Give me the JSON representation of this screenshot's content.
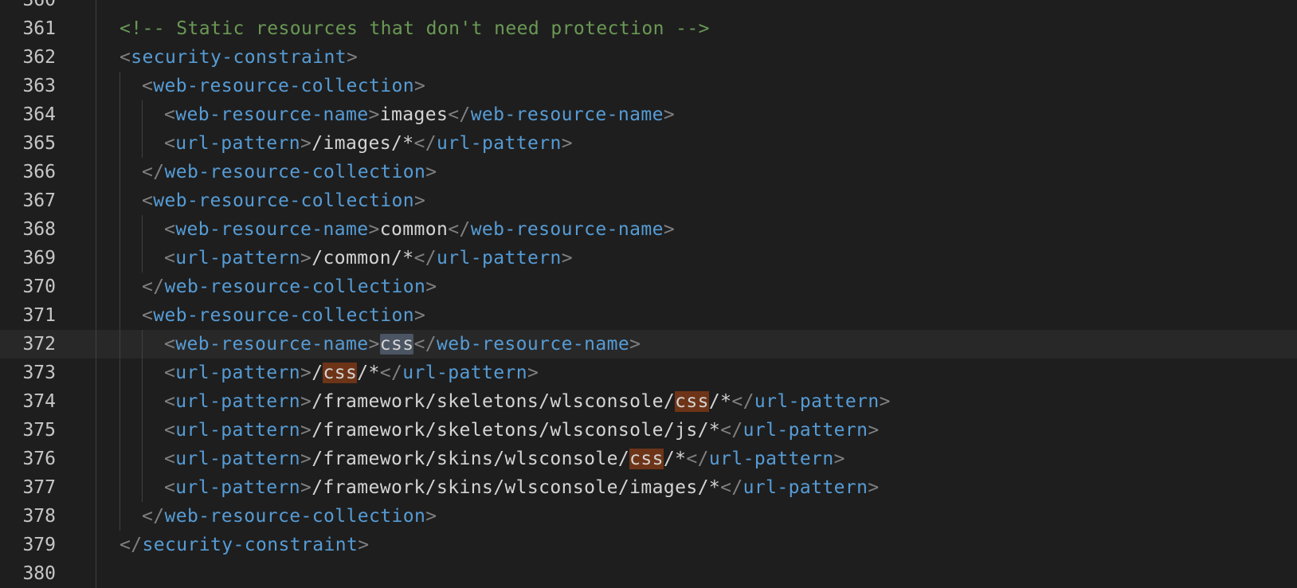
{
  "editor": {
    "lines": [
      {
        "num": "360",
        "indent": 0,
        "tokens": []
      },
      {
        "num": "361",
        "indent": 0,
        "tokens": [
          {
            "t": "comment",
            "v": "<!-- Static resources that don't need protection -->"
          }
        ]
      },
      {
        "num": "362",
        "indent": 0,
        "tokens": [
          {
            "t": "bracket",
            "v": "<"
          },
          {
            "t": "tag",
            "v": "security-constraint"
          },
          {
            "t": "bracket",
            "v": ">"
          }
        ]
      },
      {
        "num": "363",
        "indent": 1,
        "tokens": [
          {
            "t": "bracket",
            "v": "<"
          },
          {
            "t": "tag",
            "v": "web-resource-collection"
          },
          {
            "t": "bracket",
            "v": ">"
          }
        ]
      },
      {
        "num": "364",
        "indent": 2,
        "tokens": [
          {
            "t": "bracket",
            "v": "<"
          },
          {
            "t": "tag",
            "v": "web-resource-name"
          },
          {
            "t": "bracket",
            "v": ">"
          },
          {
            "t": "text",
            "v": "images"
          },
          {
            "t": "bracket",
            "v": "</"
          },
          {
            "t": "tag",
            "v": "web-resource-name"
          },
          {
            "t": "bracket",
            "v": ">"
          }
        ]
      },
      {
        "num": "365",
        "indent": 2,
        "tokens": [
          {
            "t": "bracket",
            "v": "<"
          },
          {
            "t": "tag",
            "v": "url-pattern"
          },
          {
            "t": "bracket",
            "v": ">"
          },
          {
            "t": "text",
            "v": "/images/*"
          },
          {
            "t": "bracket",
            "v": "</"
          },
          {
            "t": "tag",
            "v": "url-pattern"
          },
          {
            "t": "bracket",
            "v": ">"
          }
        ]
      },
      {
        "num": "366",
        "indent": 1,
        "tokens": [
          {
            "t": "bracket",
            "v": "</"
          },
          {
            "t": "tag",
            "v": "web-resource-collection"
          },
          {
            "t": "bracket",
            "v": ">"
          }
        ]
      },
      {
        "num": "367",
        "indent": 1,
        "tokens": [
          {
            "t": "bracket",
            "v": "<"
          },
          {
            "t": "tag",
            "v": "web-resource-collection"
          },
          {
            "t": "bracket",
            "v": ">"
          }
        ]
      },
      {
        "num": "368",
        "indent": 2,
        "tokens": [
          {
            "t": "bracket",
            "v": "<"
          },
          {
            "t": "tag",
            "v": "web-resource-name"
          },
          {
            "t": "bracket",
            "v": ">"
          },
          {
            "t": "text",
            "v": "common"
          },
          {
            "t": "bracket",
            "v": "</"
          },
          {
            "t": "tag",
            "v": "web-resource-name"
          },
          {
            "t": "bracket",
            "v": ">"
          }
        ]
      },
      {
        "num": "369",
        "indent": 2,
        "tokens": [
          {
            "t": "bracket",
            "v": "<"
          },
          {
            "t": "tag",
            "v": "url-pattern"
          },
          {
            "t": "bracket",
            "v": ">"
          },
          {
            "t": "text",
            "v": "/common/*"
          },
          {
            "t": "bracket",
            "v": "</"
          },
          {
            "t": "tag",
            "v": "url-pattern"
          },
          {
            "t": "bracket",
            "v": ">"
          }
        ]
      },
      {
        "num": "370",
        "indent": 1,
        "tokens": [
          {
            "t": "bracket",
            "v": "</"
          },
          {
            "t": "tag",
            "v": "web-resource-collection"
          },
          {
            "t": "bracket",
            "v": ">"
          }
        ]
      },
      {
        "num": "371",
        "indent": 1,
        "tokens": [
          {
            "t": "bracket",
            "v": "<"
          },
          {
            "t": "tag",
            "v": "web-resource-collection"
          },
          {
            "t": "bracket",
            "v": ">"
          }
        ]
      },
      {
        "num": "372",
        "indent": 2,
        "current": true,
        "tokens": [
          {
            "t": "bracket",
            "v": "<"
          },
          {
            "t": "tag",
            "v": "web-resource-name"
          },
          {
            "t": "bracket",
            "v": ">"
          },
          {
            "t": "text",
            "v": "css",
            "hl": "sel"
          },
          {
            "t": "bracket",
            "v": "</"
          },
          {
            "t": "tag",
            "v": "web-resource-name"
          },
          {
            "t": "bracket",
            "v": ">"
          }
        ]
      },
      {
        "num": "373",
        "indent": 2,
        "tokens": [
          {
            "t": "bracket",
            "v": "<"
          },
          {
            "t": "tag",
            "v": "url-pattern"
          },
          {
            "t": "bracket",
            "v": ">"
          },
          {
            "t": "text",
            "v": "/"
          },
          {
            "t": "text",
            "v": "css",
            "hl": "match"
          },
          {
            "t": "text",
            "v": "/*"
          },
          {
            "t": "bracket",
            "v": "</"
          },
          {
            "t": "tag",
            "v": "url-pattern"
          },
          {
            "t": "bracket",
            "v": ">"
          }
        ]
      },
      {
        "num": "374",
        "indent": 2,
        "tokens": [
          {
            "t": "bracket",
            "v": "<"
          },
          {
            "t": "tag",
            "v": "url-pattern"
          },
          {
            "t": "bracket",
            "v": ">"
          },
          {
            "t": "text",
            "v": "/framework/skeletons/wlsconsole/"
          },
          {
            "t": "text",
            "v": "css",
            "hl": "match"
          },
          {
            "t": "text",
            "v": "/*"
          },
          {
            "t": "bracket",
            "v": "</"
          },
          {
            "t": "tag",
            "v": "url-pattern"
          },
          {
            "t": "bracket",
            "v": ">"
          }
        ]
      },
      {
        "num": "375",
        "indent": 2,
        "tokens": [
          {
            "t": "bracket",
            "v": "<"
          },
          {
            "t": "tag",
            "v": "url-pattern"
          },
          {
            "t": "bracket",
            "v": ">"
          },
          {
            "t": "text",
            "v": "/framework/skeletons/wlsconsole/js/*"
          },
          {
            "t": "bracket",
            "v": "</"
          },
          {
            "t": "tag",
            "v": "url-pattern"
          },
          {
            "t": "bracket",
            "v": ">"
          }
        ]
      },
      {
        "num": "376",
        "indent": 2,
        "tokens": [
          {
            "t": "bracket",
            "v": "<"
          },
          {
            "t": "tag",
            "v": "url-pattern"
          },
          {
            "t": "bracket",
            "v": ">"
          },
          {
            "t": "text",
            "v": "/framework/skins/wlsconsole/"
          },
          {
            "t": "text",
            "v": "css",
            "hl": "match"
          },
          {
            "t": "text",
            "v": "/*"
          },
          {
            "t": "bracket",
            "v": "</"
          },
          {
            "t": "tag",
            "v": "url-pattern"
          },
          {
            "t": "bracket",
            "v": ">"
          }
        ]
      },
      {
        "num": "377",
        "indent": 2,
        "tokens": [
          {
            "t": "bracket",
            "v": "<"
          },
          {
            "t": "tag",
            "v": "url-pattern"
          },
          {
            "t": "bracket",
            "v": ">"
          },
          {
            "t": "text",
            "v": "/framework/skins/wlsconsole/images/*"
          },
          {
            "t": "bracket",
            "v": "</"
          },
          {
            "t": "tag",
            "v": "url-pattern"
          },
          {
            "t": "bracket",
            "v": ">"
          }
        ]
      },
      {
        "num": "378",
        "indent": 1,
        "tokens": [
          {
            "t": "bracket",
            "v": "</"
          },
          {
            "t": "tag",
            "v": "web-resource-collection"
          },
          {
            "t": "bracket",
            "v": ">"
          }
        ]
      },
      {
        "num": "379",
        "indent": 0,
        "tokens": [
          {
            "t": "bracket",
            "v": "</"
          },
          {
            "t": "tag",
            "v": "security-constraint"
          },
          {
            "t": "bracket",
            "v": ">"
          }
        ]
      },
      {
        "num": "380",
        "indent": 0,
        "tokens": []
      }
    ]
  },
  "colors": {
    "background": "#1e1e1e",
    "current_line": "#282828",
    "tag": "#569cd6",
    "bracket": "#808080",
    "text": "#d4d4d4",
    "comment": "#6a9955",
    "selection_highlight": "#4b5563",
    "match_highlight": "#6e3417"
  }
}
